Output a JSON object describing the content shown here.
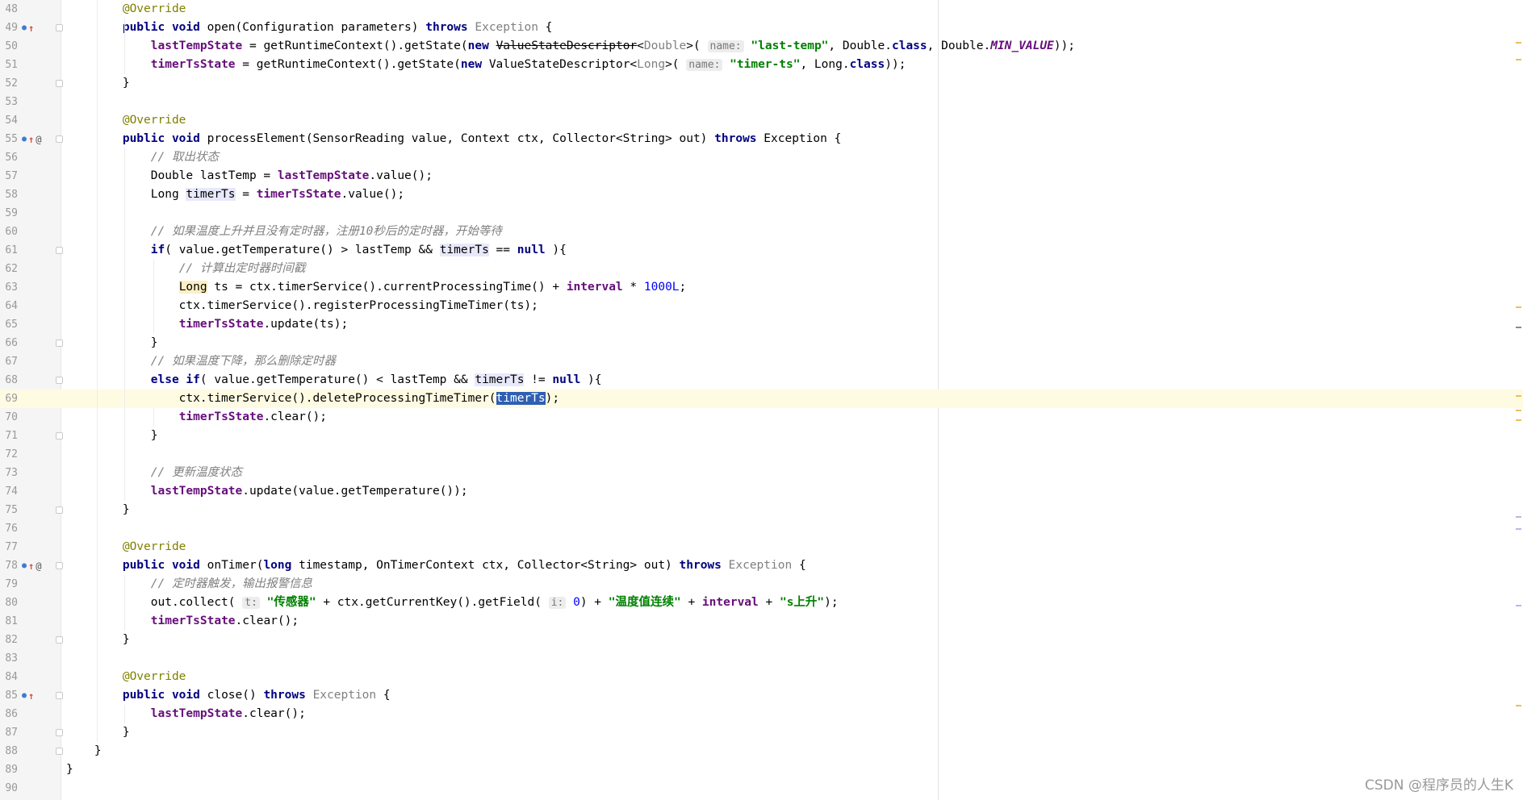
{
  "editor": {
    "lines": [
      {
        "n": "48",
        "cls": "",
        "fold": false,
        "icons": [],
        "html": "        <span class=\"ann\">@Override</span>"
      },
      {
        "n": "49",
        "cls": "",
        "fold": true,
        "icons": [
          "impl",
          "arrow"
        ],
        "html": "        <span class=\"kw\">public void</span> open(Configuration parameters) <span class=\"kw\">throws</span> <span class=\"gray\">Exception</span> {"
      },
      {
        "n": "50",
        "cls": "",
        "fold": false,
        "icons": [],
        "html": "            <span class=\"fld\">lastTempState</span> = getRuntimeContext().getState(<span class=\"kw\">new</span> <span class=\"strike\">ValueStateDescriptor</span>&lt;<span class=\"gray\">Double</span>&gt;( <span class=\"hint\">name:</span> <span class=\"str\">\"last-temp\"</span>, Double.<span class=\"kw\">class</span>, Double.<span class=\"static\">MIN_VALUE</span>));"
      },
      {
        "n": "51",
        "cls": "",
        "fold": false,
        "icons": [],
        "html": "            <span class=\"fld\">timerTsState</span> = getRuntimeContext().getState(<span class=\"kw\">new</span> ValueStateDescriptor&lt;<span class=\"gray\">Long</span>&gt;( <span class=\"hint\">name:</span> <span class=\"str\">\"timer-ts\"</span>, Long.<span class=\"kw\">class</span>));"
      },
      {
        "n": "52",
        "cls": "",
        "fold": true,
        "icons": [],
        "html": "        }"
      },
      {
        "n": "53",
        "cls": "",
        "fold": false,
        "icons": [],
        "html": ""
      },
      {
        "n": "54",
        "cls": "",
        "fold": false,
        "icons": [],
        "html": "        <span class=\"ann\">@Override</span>"
      },
      {
        "n": "55",
        "cls": "",
        "fold": true,
        "icons": [
          "impl",
          "arrow",
          "at"
        ],
        "html": "        <span class=\"kw\">public void</span> processElement(SensorReading value, Context ctx, Collector&lt;String&gt; out) <span class=\"kw\">throws</span> Exception {"
      },
      {
        "n": "56",
        "cls": "",
        "fold": false,
        "icons": [],
        "html": "            <span class=\"cmt\">// 取出状态</span>"
      },
      {
        "n": "57",
        "cls": "",
        "fold": false,
        "icons": [],
        "html": "            Double lastTemp = <span class=\"fld\">lastTempState</span>.value();"
      },
      {
        "n": "58",
        "cls": "",
        "fold": false,
        "icons": [],
        "html": "            Long <span class=\"var-hl\">timerTs</span> = <span class=\"fld\">timerTsState</span>.value();"
      },
      {
        "n": "59",
        "cls": "",
        "fold": false,
        "icons": [],
        "html": ""
      },
      {
        "n": "60",
        "cls": "",
        "fold": false,
        "icons": [],
        "html": "            <span class=\"cmt\">// 如果温度上升并且没有定时器，注册10秒后的定时器，开始等待</span>"
      },
      {
        "n": "61",
        "cls": "",
        "fold": true,
        "icons": [],
        "html": "            <span class=\"kw\">if</span>( value.getTemperature() &gt; lastTemp &amp;&amp; <span class=\"var-hl\">timerTs</span> == <span class=\"kw\">null</span> ){"
      },
      {
        "n": "62",
        "cls": "",
        "fold": false,
        "icons": [],
        "html": "                <span class=\"cmt\">// 计算出定时器时间戳</span>"
      },
      {
        "n": "63",
        "cls": "",
        "fold": false,
        "icons": [],
        "html": "                <span class=\"warn-hl\">Long</span> ts = ctx.timerService().currentProcessingTime() + <span class=\"fld\">interval</span> * <span class=\"num\">1000L</span>;"
      },
      {
        "n": "64",
        "cls": "",
        "fold": false,
        "icons": [],
        "html": "                ctx.timerService().registerProcessingTimeTimer(ts);"
      },
      {
        "n": "65",
        "cls": "",
        "fold": false,
        "icons": [],
        "html": "                <span class=\"fld\">timerTsState</span>.update(ts);"
      },
      {
        "n": "66",
        "cls": "",
        "fold": true,
        "icons": [],
        "html": "            }"
      },
      {
        "n": "67",
        "cls": "",
        "fold": false,
        "icons": [],
        "html": "            <span class=\"cmt\">// 如果温度下降，那么删除定时器</span>"
      },
      {
        "n": "68",
        "cls": "",
        "fold": true,
        "icons": [],
        "html": "            <span class=\"kw\">else if</span>( value.getTemperature() &lt; lastTemp &amp;&amp; <span class=\"var-hl\">timerTs</span> != <span class=\"kw\">null</span> ){"
      },
      {
        "n": "69",
        "cls": "current",
        "fold": false,
        "icons": [],
        "html": "                ctx.timerService().deleteProcessingTimeTimer(<span class=\"sel\">timerTs</span>);"
      },
      {
        "n": "70",
        "cls": "",
        "fold": false,
        "icons": [],
        "html": "                <span class=\"fld\">timerTsState</span>.clear();"
      },
      {
        "n": "71",
        "cls": "",
        "fold": true,
        "icons": [],
        "html": "            }"
      },
      {
        "n": "72",
        "cls": "",
        "fold": false,
        "icons": [],
        "html": ""
      },
      {
        "n": "73",
        "cls": "",
        "fold": false,
        "icons": [],
        "html": "            <span class=\"cmt\">// 更新温度状态</span>"
      },
      {
        "n": "74",
        "cls": "",
        "fold": false,
        "icons": [],
        "html": "            <span class=\"fld\">lastTempState</span>.update(value.getTemperature());"
      },
      {
        "n": "75",
        "cls": "",
        "fold": true,
        "icons": [],
        "html": "        }"
      },
      {
        "n": "76",
        "cls": "",
        "fold": false,
        "icons": [],
        "html": ""
      },
      {
        "n": "77",
        "cls": "",
        "fold": false,
        "icons": [],
        "html": "        <span class=\"ann\">@Override</span>"
      },
      {
        "n": "78",
        "cls": "",
        "fold": true,
        "icons": [
          "impl",
          "arrow",
          "at"
        ],
        "html": "        <span class=\"kw\">public void</span> onTimer(<span class=\"kw\">long</span> timestamp, OnTimerContext ctx, Collector&lt;String&gt; out) <span class=\"kw\">throws</span> <span class=\"gray\">Exception</span> {"
      },
      {
        "n": "79",
        "cls": "",
        "fold": false,
        "icons": [],
        "html": "            <span class=\"cmt\">// 定时器触发，输出报警信息</span>"
      },
      {
        "n": "80",
        "cls": "",
        "fold": false,
        "icons": [],
        "html": "            out.collect( <span class=\"hint\">t:</span> <span class=\"str\">\"传感器\"</span> + ctx.getCurrentKey().getField( <span class=\"hint\">i:</span> <span class=\"num\">0</span>) + <span class=\"str\">\"温度值连续\"</span> + <span class=\"fld\">interval</span> + <span class=\"str\">\"s上升\"</span>);"
      },
      {
        "n": "81",
        "cls": "",
        "fold": false,
        "icons": [],
        "html": "            <span class=\"fld\">timerTsState</span>.clear();"
      },
      {
        "n": "82",
        "cls": "",
        "fold": true,
        "icons": [],
        "html": "        }"
      },
      {
        "n": "83",
        "cls": "",
        "fold": false,
        "icons": [],
        "html": ""
      },
      {
        "n": "84",
        "cls": "",
        "fold": false,
        "icons": [],
        "html": "        <span class=\"ann\">@Override</span>"
      },
      {
        "n": "85",
        "cls": "",
        "fold": true,
        "icons": [
          "impl",
          "arrow"
        ],
        "html": "        <span class=\"kw\">public void</span> close() <span class=\"kw\">throws</span> <span class=\"gray\">Exception</span> {"
      },
      {
        "n": "86",
        "cls": "",
        "fold": false,
        "icons": [],
        "html": "            <span class=\"fld\">lastTempState</span>.clear();"
      },
      {
        "n": "87",
        "cls": "",
        "fold": true,
        "icons": [],
        "html": "        }"
      },
      {
        "n": "88",
        "cls": "",
        "fold": true,
        "icons": [],
        "html": "    }"
      },
      {
        "n": "89",
        "cls": "",
        "fold": false,
        "icons": [],
        "html": "}"
      },
      {
        "n": "90",
        "cls": "",
        "fold": false,
        "icons": [],
        "html": ""
      }
    ]
  },
  "colors": {
    "keyword": "#000080",
    "annotation": "#808000",
    "field": "#660e7a",
    "string": "#008000",
    "comment": "#808080",
    "selection": "#2f5fb4",
    "current_line": "#fffbe3"
  },
  "icons": {
    "impl": "implements-marker-icon",
    "arrow": "override-arrow-icon",
    "at": "annotation-at-icon",
    "fold": "fold-marker-icon"
  },
  "watermark": "CSDN @程序员的人生K"
}
